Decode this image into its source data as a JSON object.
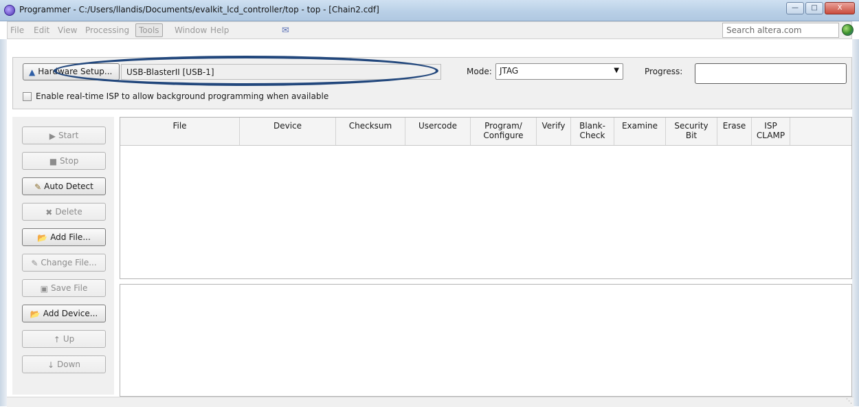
{
  "window": {
    "title": "Programmer - C:/Users/llandis/Documents/evalkit_lcd_controller/top - top - [Chain2.cdf]",
    "controls": {
      "minimize": "—",
      "maximize": "□",
      "close": "X"
    }
  },
  "menu": {
    "items": [
      "File",
      "Edit",
      "View",
      "Processing",
      "Tools",
      "Window",
      "Help"
    ],
    "search_placeholder": "Search altera.com"
  },
  "hardware": {
    "setup_label": "Hardware Setup...",
    "device": "USB-BlasterII [USB-1]",
    "mode_label": "Mode:",
    "mode_value": "JTAG",
    "progress_label": "Progress:",
    "progress_value": "",
    "isp_checkbox_label": "Enable real-time ISP to allow background programming when available",
    "isp_checked": false
  },
  "side_buttons": [
    {
      "label": "Start",
      "icon": "start-icon",
      "enabled": false
    },
    {
      "label": "Stop",
      "icon": "stop-icon",
      "enabled": false
    },
    {
      "label": "Auto Detect",
      "icon": "auto-detect-icon",
      "enabled": true
    },
    {
      "label": "Delete",
      "icon": "delete-icon",
      "enabled": false
    },
    {
      "label": "Add File...",
      "icon": "add-file-icon",
      "enabled": true
    },
    {
      "label": "Change File...",
      "icon": "change-file-icon",
      "enabled": false
    },
    {
      "label": "Save File",
      "icon": "save-file-icon",
      "enabled": false
    },
    {
      "label": "Add Device...",
      "icon": "add-device-icon",
      "enabled": true
    },
    {
      "label": "Up",
      "icon": "up-icon",
      "enabled": false
    },
    {
      "label": "Down",
      "icon": "down-icon",
      "enabled": false
    }
  ],
  "table": {
    "columns": [
      {
        "label": "File"
      },
      {
        "label": "Device"
      },
      {
        "label": "Checksum"
      },
      {
        "label": "Usercode"
      },
      {
        "label": "Program/\nConfigure"
      },
      {
        "label": "Verify"
      },
      {
        "label": "Blank-\nCheck"
      },
      {
        "label": "Examine"
      },
      {
        "label": "Security\nBit"
      },
      {
        "label": "Erase"
      },
      {
        "label": "ISP\nCLAMP"
      }
    ],
    "rows": []
  },
  "colors": {
    "annotation": "#22477c",
    "title_bar": "#b8cfe6"
  }
}
